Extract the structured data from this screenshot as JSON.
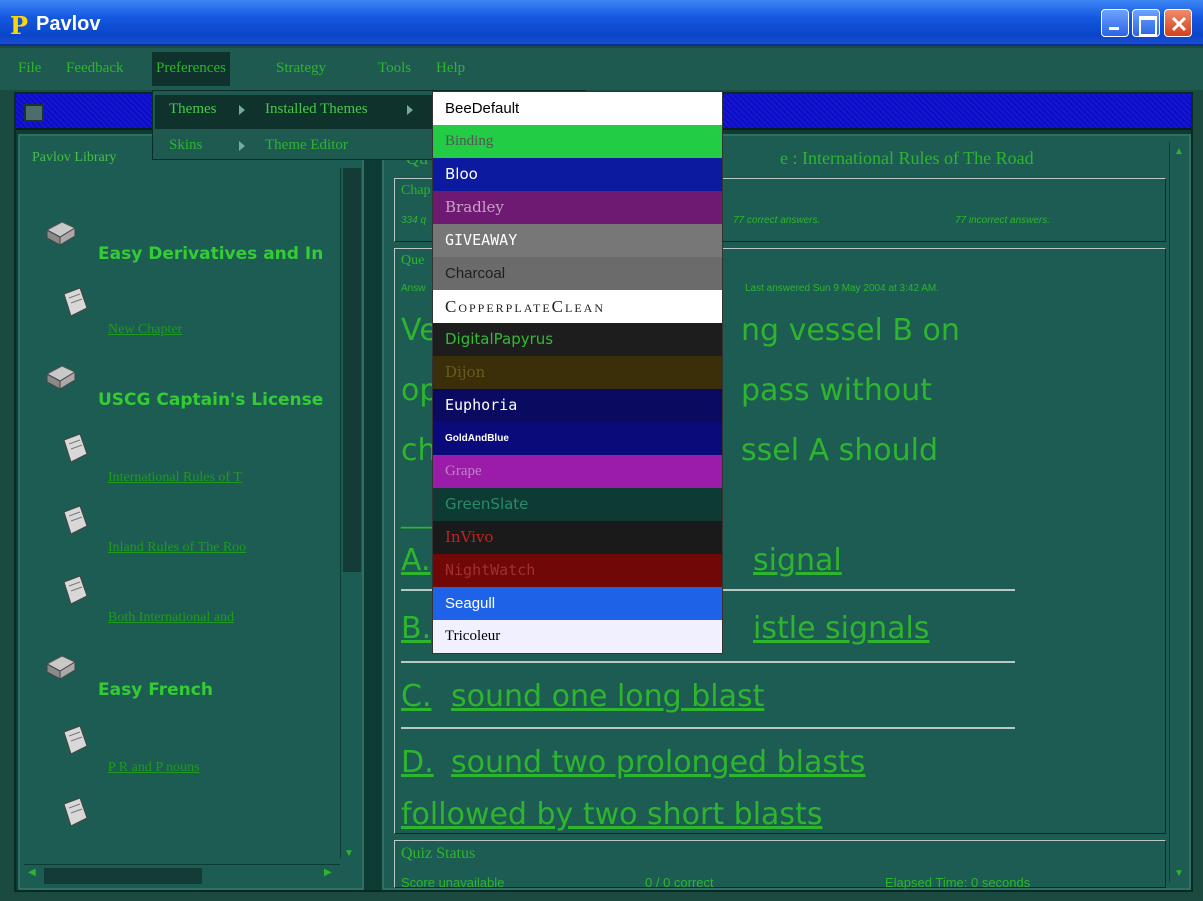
{
  "window": {
    "title": "Pavlov",
    "logo_letter": "P"
  },
  "menubar": {
    "items": [
      "File",
      "Feedback",
      "Preferences",
      "Strategy",
      "Tools",
      "Help"
    ],
    "active": "Preferences"
  },
  "preferences_menu": {
    "items": [
      {
        "label": "Themes",
        "has_submenu": true
      },
      {
        "label": "Skins",
        "has_submenu": true
      }
    ],
    "themes_submenu": [
      "Installed Themes",
      "Theme Editor"
    ]
  },
  "installed_themes": [
    {
      "name": "BeeDefault",
      "bg": "#ffffff",
      "fg": "#000000"
    },
    {
      "name": "Binding",
      "bg": "#22cc44",
      "fg": "#555555"
    },
    {
      "name": "Bloo",
      "bg": "#0b1a9e",
      "fg": "#ffffff"
    },
    {
      "name": "Bradley",
      "bg": "#6e1a72",
      "fg": "#c9a0c9"
    },
    {
      "name": "GIVEAWAY",
      "bg": "#777777",
      "fg": "#ffffff"
    },
    {
      "name": "Charcoal",
      "bg": "#6b6b6b",
      "fg": "#1f1f1f"
    },
    {
      "name": "CopperplateClean",
      "bg": "#ffffff",
      "fg": "#222222"
    },
    {
      "name": "DigitalPapyrus",
      "bg": "#1d1d1d",
      "fg": "#33bb33"
    },
    {
      "name": "Dijon",
      "bg": "#3a2f08",
      "fg": "#6b5a20"
    },
    {
      "name": "Euphoria",
      "bg": "#0a0a60",
      "fg": "#ffffff"
    },
    {
      "name": "GoldAndBlue",
      "bg": "#0a0a7a",
      "fg": "#ffffff"
    },
    {
      "name": "Grape",
      "bg": "#9b1ca8",
      "fg": "#c080c8"
    },
    {
      "name": "GreenSlate",
      "bg": "#0d3a33",
      "fg": "#2a8a6a"
    },
    {
      "name": "InVivo",
      "bg": "#1a1a1a",
      "fg": "#c82020"
    },
    {
      "name": "NightWatch",
      "bg": "#700808",
      "fg": "#a03030"
    },
    {
      "name": "Seagull",
      "bg": "#1e62e8",
      "fg": "#ffffff"
    },
    {
      "name": "Tricoleur",
      "bg": "#f0f0ff",
      "fg": "#000000"
    }
  ],
  "library": {
    "header": "Pavlov Library",
    "books": [
      {
        "title": "Easy Derivatives and In",
        "chapters": [
          "New Chapter"
        ]
      },
      {
        "title": "USCG Captain's License",
        "chapters": [
          "International Rules of T",
          "Inland Rules of The Roo",
          "Both International and "
        ]
      },
      {
        "title": "Easy French",
        "chapters": [
          "P R and P nouns",
          ""
        ]
      }
    ]
  },
  "main": {
    "header_visible_left": "Qu",
    "header_visible_right": "e : International Rules of The Road",
    "chapter_box": {
      "label": "Chap",
      "stats_left": "334 q",
      "correct": "77 correct answers.",
      "incorrect": "77 incorrect answers."
    },
    "question_box": {
      "label": "Que",
      "meta_left": "Answ",
      "last_answered": "Last answered Sun 9 May 2004 at 3:42 AM.",
      "question_lines": [
        "Ve",
        "ng vessel B on",
        "op",
        "pass without",
        "ch",
        "ssel A should"
      ],
      "blank": "________________."
    },
    "answers": [
      {
        "letter": "A.",
        "visible_text": "signal"
      },
      {
        "letter": "B.",
        "visible_text": "istle signals"
      },
      {
        "letter": "C.",
        "visible_text": "sound one long blast"
      },
      {
        "letter": "D.",
        "visible_text": "sound two prolonged blasts",
        "second_line": "followed by two short blasts"
      }
    ],
    "quiz_status": {
      "label": "Quiz Status",
      "state": "Score unavailable",
      "correct": "0 / 0 correct",
      "elapsed": "Elapsed Time: 0 seconds"
    }
  },
  "colors": {
    "menu_text": "#2db52d",
    "panel_bg": "#1d5c52",
    "workspace_bg": "#0e3b33",
    "title_bar": "#1457e0"
  }
}
